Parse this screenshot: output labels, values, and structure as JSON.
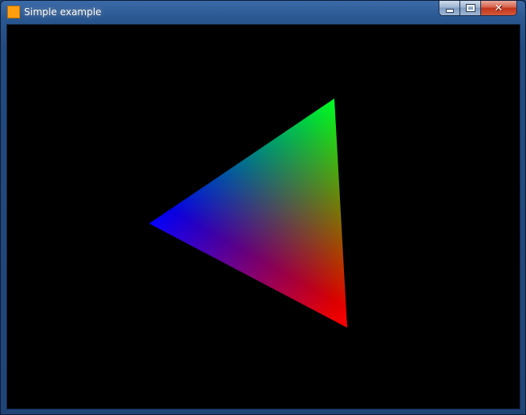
{
  "window": {
    "title": "Simple example",
    "icon": "orange-square-app-icon",
    "controls": {
      "minimize": "minimize-icon",
      "maximize": "maximize-icon",
      "close": "close-icon",
      "close_glyph": "✕"
    }
  },
  "canvas": {
    "background": "#000000",
    "triangle": {
      "vertex_colors": {
        "top": "#00ff00",
        "left": "#0000ff",
        "bottom": "#ff0000"
      }
    }
  }
}
